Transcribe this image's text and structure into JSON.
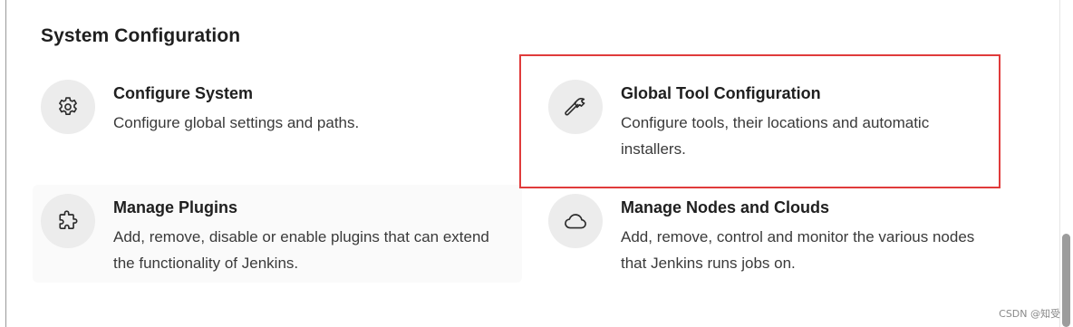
{
  "section": {
    "title": "System Configuration"
  },
  "cards": {
    "configure_system": {
      "title": "Configure System",
      "description": "Configure global settings and paths.",
      "icon": "gear-icon"
    },
    "global_tool": {
      "title": "Global Tool Configuration",
      "description": "Configure tools, their locations and automatic installers.",
      "icon": "hammer-icon"
    },
    "manage_plugins": {
      "title": "Manage Plugins",
      "description": "Add, remove, disable or enable plugins that can extend the functionality of Jenkins.",
      "icon": "puzzle-icon"
    },
    "manage_nodes": {
      "title": "Manage Nodes and Clouds",
      "description": "Add, remove, control and monitor the various nodes that Jenkins runs jobs on.",
      "icon": "cloud-icon"
    }
  },
  "annotation": {
    "highlight_color": "#e03b3b"
  },
  "watermark": {
    "text": "CSDN @知受"
  }
}
